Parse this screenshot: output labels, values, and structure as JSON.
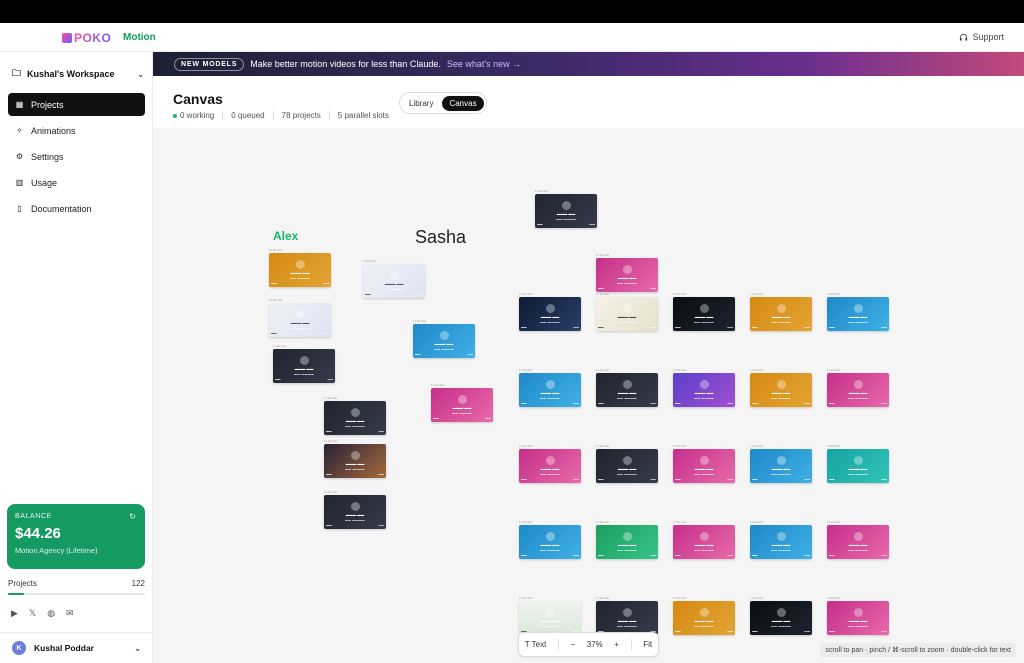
{
  "topbar": {
    "logo_text": "POKO",
    "product": "Motion",
    "support_label": "Support",
    "support_icon": "headset-icon"
  },
  "sidebar": {
    "workspace": "Kushal's Workspace",
    "nav": [
      {
        "label": "Projects",
        "icon": "grid-icon",
        "active": true
      },
      {
        "label": "Animations",
        "icon": "sparkle-icon",
        "active": false
      },
      {
        "label": "Settings",
        "icon": "gear-icon",
        "active": false
      },
      {
        "label": "Usage",
        "icon": "chart-icon",
        "active": false
      },
      {
        "label": "Documentation",
        "icon": "book-icon",
        "active": false
      }
    ],
    "balance": {
      "label": "BALANCE",
      "amount": "$44.26",
      "subtitle": "Motion Agency (Lifetime)"
    },
    "projects_label": "Projects",
    "projects_count": "122",
    "user_initial": "K",
    "user_name": "Kushal Poddar"
  },
  "banner": {
    "pill": "NEW MODELS",
    "text": "Make better motion videos for less than Claude.",
    "link": "See what's new →"
  },
  "header": {
    "title": "Canvas",
    "stats": [
      "0 working",
      "0 queued",
      "78 projects",
      "5 parallel slots"
    ],
    "toggle": [
      "Library",
      "Canvas"
    ],
    "toggle_active": "Canvas"
  },
  "canvas": {
    "groups": [
      "Alex",
      "Sasha"
    ]
  },
  "zoombar": {
    "text_tool": "Text",
    "minus": "−",
    "zoom": "37%",
    "plus": "+",
    "fit": "Fit"
  },
  "hint": "scroll to pan · pinch / ⌘-scroll to zoom · double-click for text",
  "colors": {
    "accent_green": "#159a62",
    "alex_label": "#17b86a",
    "active_nav": "#111111"
  }
}
